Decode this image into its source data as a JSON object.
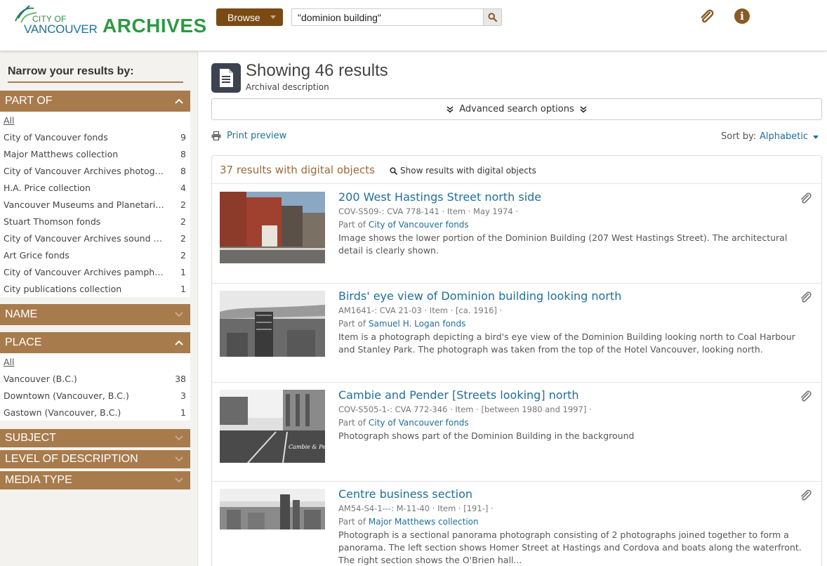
{
  "header": {
    "logo": {
      "city_of": "CITY OF",
      "vancouver": "VANCOUVER",
      "archives": "ARCHIVES"
    },
    "browse_label": "Browse",
    "search_value": "\"dominion building\"",
    "icons": {
      "search": "search-icon",
      "clipboard": "paperclip-icon",
      "info": "info-icon"
    }
  },
  "sidebar": {
    "title": "Narrow your results by:",
    "part_of": {
      "label": "PART OF",
      "all": "All",
      "items": [
        {
          "label": "City of Vancouver fonds",
          "count": "9"
        },
        {
          "label": "Major Matthews collection",
          "count": "8"
        },
        {
          "label": "City of Vancouver Archives photog…",
          "count": "8"
        },
        {
          "label": "H.A. Price collection",
          "count": "4"
        },
        {
          "label": "Vancouver Museums and Planetari…",
          "count": "2"
        },
        {
          "label": "Stuart Thomson fonds",
          "count": "2"
        },
        {
          "label": "City of Vancouver Archives sound …",
          "count": "2"
        },
        {
          "label": "Art Grice fonds",
          "count": "2"
        },
        {
          "label": "City of Vancouver Archives pamphl…",
          "count": "1"
        },
        {
          "label": "City publications collection",
          "count": "1"
        }
      ]
    },
    "name": {
      "label": "NAME"
    },
    "place": {
      "label": "PLACE",
      "all": "All",
      "items": [
        {
          "label": "Vancouver (B.C.)",
          "count": "38"
        },
        {
          "label": "Downtown (Vancouver, B.C.)",
          "count": "3"
        },
        {
          "label": "Gastown (Vancouver, B.C.)",
          "count": "1"
        }
      ]
    },
    "subject": {
      "label": "SUBJECT"
    },
    "level": {
      "label": "LEVEL OF DESCRIPTION"
    },
    "media": {
      "label": "MEDIA TYPE"
    }
  },
  "main": {
    "title": "Showing 46 results",
    "subtitle": "Archival description",
    "advanced_search": "Advanced search options",
    "print_preview": "Print preview",
    "sort_label": "Sort by:",
    "sort_value": "Alphabetic",
    "digital_count": "37 results with digital objects",
    "show_digital": "Show results with digital objects",
    "results": [
      {
        "title": "200 West Hastings Street north side",
        "meta": "COV-S509-: CVA 778-141 · Item · May 1974 ·",
        "part_of_prefix": "Part of",
        "part_of": "City of Vancouver fonds",
        "description": "Image shows the lower portion of the Dominion Building (207 West Hastings Street). The architectural detail is clearly shown."
      },
      {
        "title": "Birds' eye view of Dominion building looking north",
        "meta": "AM1641-: CVA 21-03 · Item · [ca. 1916] ·",
        "part_of_prefix": "Part of",
        "part_of": "Samuel H. Logan fonds",
        "description": "Item is a photograph depicting a bird's eye view of the Dominion Building looking north to Coal Harbour and Stanley Park. The photograph was taken from the top of the Hotel Vancouver, looking north."
      },
      {
        "title": "Cambie and Pender [Streets looking] north",
        "meta": "COV-S505-1-: CVA 772-346 · Item · [between 1980 and 1997] ·",
        "part_of_prefix": "Part of",
        "part_of": "City of Vancouver fonds",
        "description": "Photograph shows part of the Dominion Building in the background"
      },
      {
        "title": "Centre business section",
        "meta": "AM54-S4-1---: M-11-40 · Item · [191-] ·",
        "part_of_prefix": "Part of",
        "part_of": "Major Matthews collection",
        "description": "Photograph is a sectional panorama photograph consisting of 2 photographs joined together to form a panorama. The left section shows Homer Street at Hastings and Cordova and boats along the waterfront. The right section shows the O'Brien hall..."
      }
    ]
  },
  "colors": {
    "facet_brown": "#a87b4c",
    "browse_brown": "#7a4a14",
    "link_blue": "#1f6f9a",
    "logo_green": "#2d9a43",
    "digital_count_brown": "#9a6a3a"
  }
}
